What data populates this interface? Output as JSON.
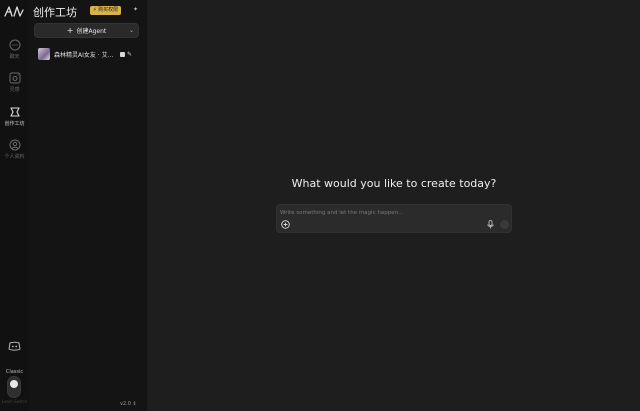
{
  "rail": {
    "items": [
      {
        "label": "聊天"
      },
      {
        "label": "灵感"
      },
      {
        "label": "创作工坊"
      },
      {
        "label": "个人资料"
      }
    ],
    "mode_label": "Classic",
    "mode_sub": "Learn Switch"
  },
  "panel": {
    "title": "创作工坊",
    "credit": "⚡ 购买权限",
    "create_button": "创建Agent",
    "agents": [
      {
        "name": "森林精灵AI女友 · 艾..."
      }
    ],
    "version": "v2.0"
  },
  "main": {
    "headline": "What would you like to create today?",
    "prompt_placeholder": "Write something and let the magic happen..."
  },
  "colors": {
    "accent_gold": "#d9b34a",
    "background": "#1e1e1e",
    "sidebar": "#141414"
  }
}
